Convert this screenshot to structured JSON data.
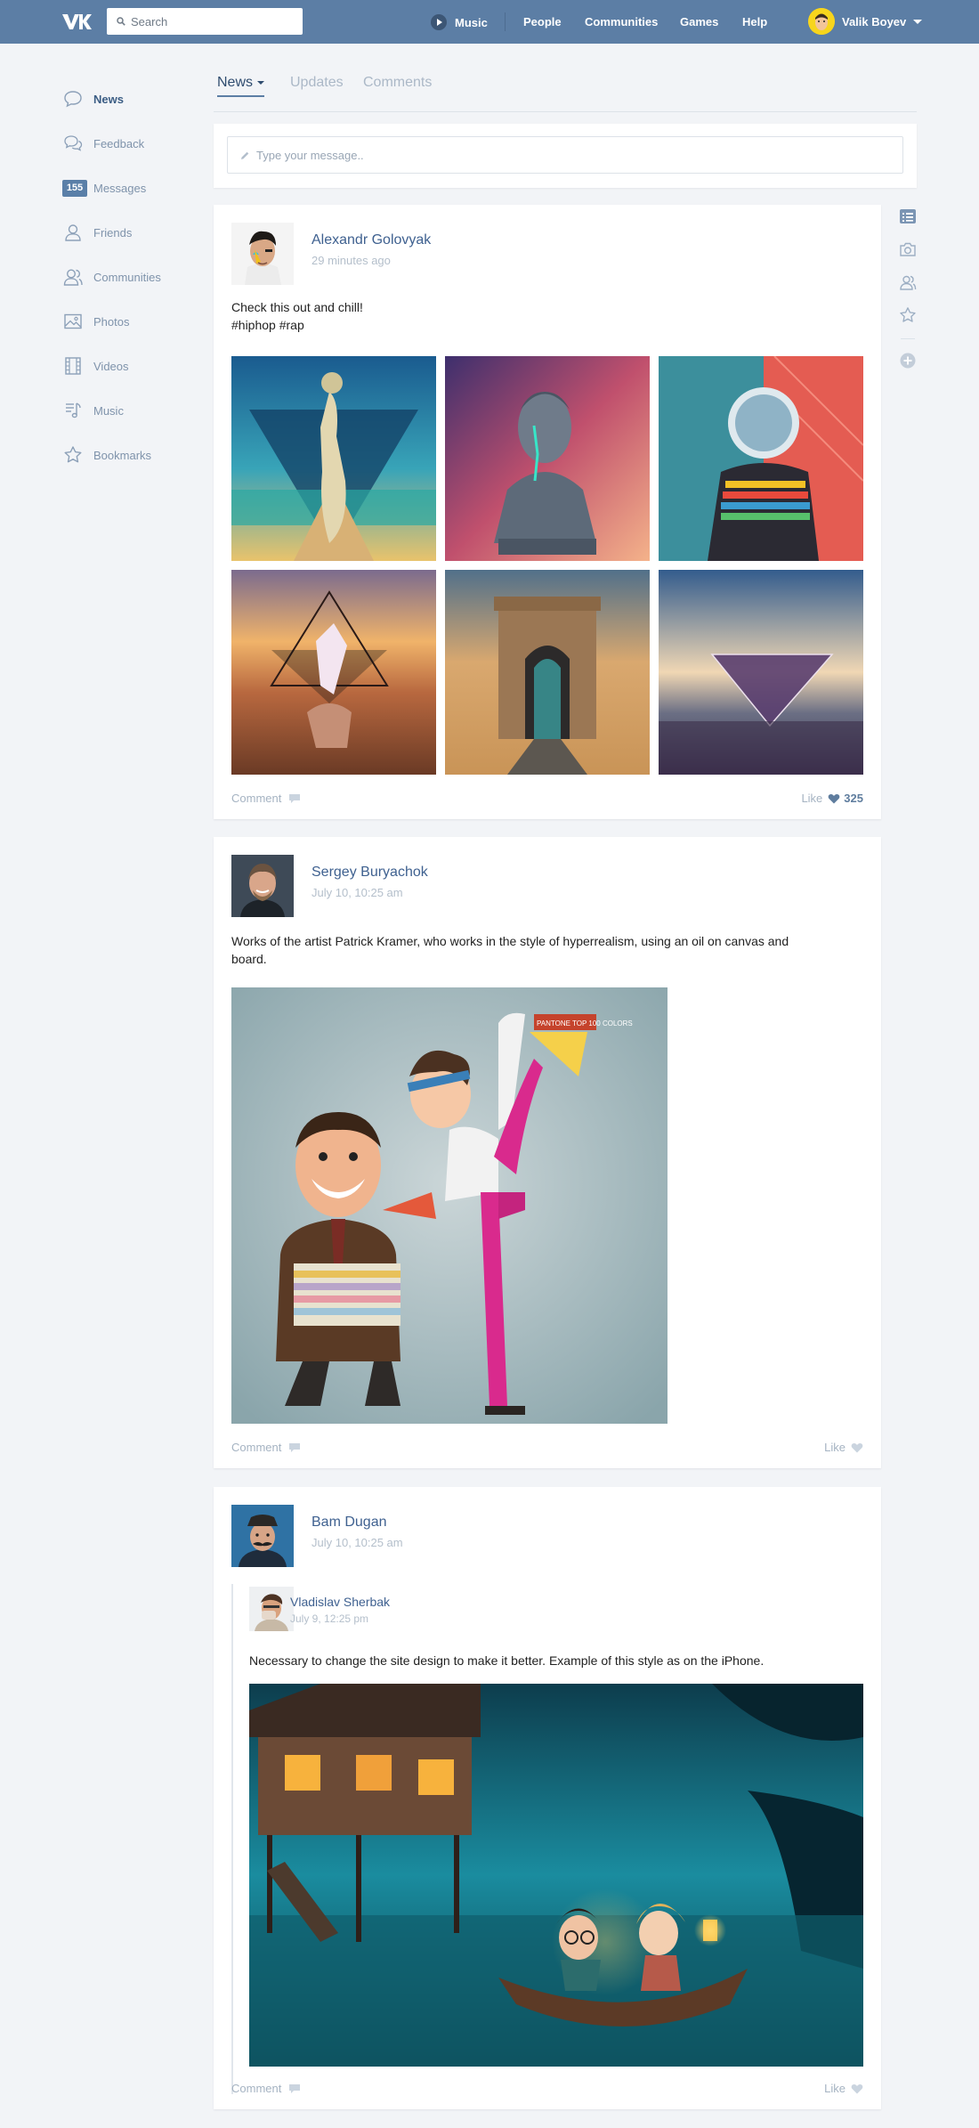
{
  "header": {
    "search_placeholder": "Search",
    "nav": {
      "music": "Music",
      "people": "People",
      "communities": "Communities",
      "games": "Games",
      "help": "Help"
    },
    "user_name": "Valik Boyev"
  },
  "sidebar": {
    "items": [
      {
        "label": "News",
        "icon": "chat-bubble-icon"
      },
      {
        "label": "Feedback",
        "icon": "chat-bubbles-icon"
      },
      {
        "label": "Messages",
        "icon": "badge",
        "badge": "155"
      },
      {
        "label": "Friends",
        "icon": "person-icon"
      },
      {
        "label": "Communities",
        "icon": "people-icon"
      },
      {
        "label": "Photos",
        "icon": "image-icon"
      },
      {
        "label": "Videos",
        "icon": "film-icon"
      },
      {
        "label": "Music",
        "icon": "music-note-icon"
      },
      {
        "label": "Bookmarks",
        "icon": "star-icon"
      }
    ]
  },
  "tabs": [
    {
      "label": "News"
    },
    {
      "label": "Updates"
    },
    {
      "label": "Comments"
    }
  ],
  "composer": {
    "placeholder": "Type your message.."
  },
  "posts": [
    {
      "author": "Alexandr Golovyak",
      "time": "29 minutes ago",
      "text": "Check this out and chill!",
      "hashtags": "#hiphop #rap",
      "comment_label": "Comment",
      "like_label": "Like",
      "like_count": "325"
    },
    {
      "author": "Sergey Buryachok",
      "time": "July 10, 10:25 am",
      "text_line1": "Works of the artist Patrick Kramer, who works in the style of hyperrealism, using an oil on canvas and",
      "text_line2": "board.",
      "comment_label": "Comment",
      "like_label": "Like"
    },
    {
      "author": "Bam Dugan",
      "time": "July 10, 10:25 am",
      "repost": {
        "author": "Vladislav Sherbak",
        "time": "July 9, 12:25 pm",
        "text": "Necessary to change the site design to make it better. Example of this style as on the iPhone."
      },
      "comment_label": "Comment",
      "like_label": "Like"
    }
  ],
  "card_text": "PANTONE TOP 100 COLORS",
  "colors": {
    "header": "#5c7ea5",
    "accent": "#3f6190",
    "background": "#f2f4f7"
  }
}
